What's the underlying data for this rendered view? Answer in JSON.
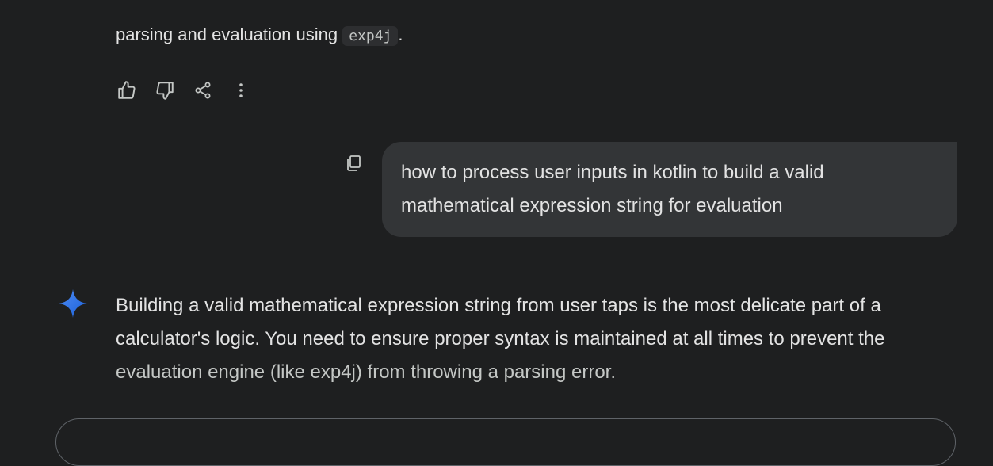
{
  "previous_response": {
    "text_before": "parsing and evaluation using ",
    "code": "exp4j",
    "text_after": "."
  },
  "actions": {
    "icons": [
      "thumbs-up-icon",
      "thumbs-down-icon",
      "share-icon",
      "more-vert-icon"
    ]
  },
  "user_message": {
    "line1": "how to process user inputs in kotlin to build a valid",
    "line2": "mathematical expression string for evaluation"
  },
  "assistant": {
    "line1": "Building a valid mathematical expression string from user taps is the most delicate part of a",
    "line2": "calculator's logic. You need to ensure proper syntax is maintained at all times to prevent the",
    "line3": "evaluation engine (like exp4j) from throwing a parsing error."
  },
  "colors": {
    "background": "#1e1f20",
    "bubble": "#333537",
    "accent": "#4285f4"
  }
}
